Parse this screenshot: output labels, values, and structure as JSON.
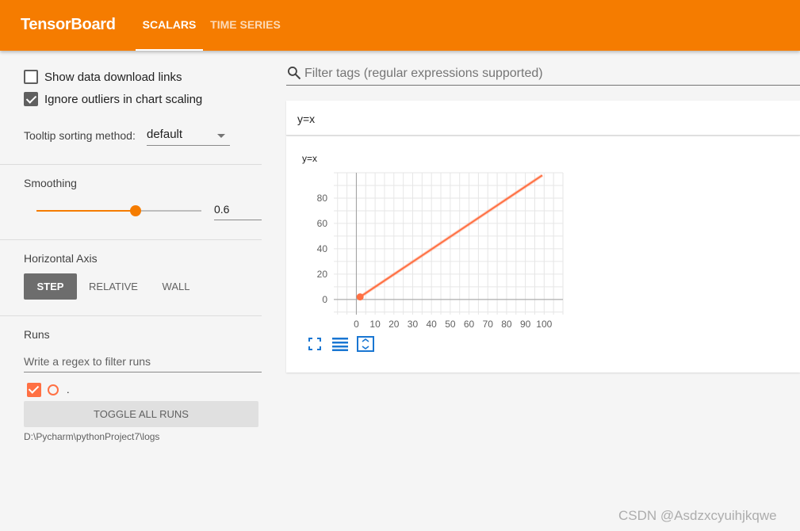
{
  "header": {
    "brand": "TensorBoard",
    "tabs": [
      {
        "label": "SCALARS",
        "active": true
      },
      {
        "label": "TIME SERIES",
        "active": false
      }
    ],
    "accent_color": "#f57c00"
  },
  "sidebar": {
    "show_download_links": {
      "label": "Show data download links",
      "checked": false
    },
    "ignore_outliers": {
      "label": "Ignore outliers in chart scaling",
      "checked": true
    },
    "tooltip_sorting": {
      "label": "Tooltip sorting method:",
      "value": "default"
    },
    "smoothing": {
      "title": "Smoothing",
      "value": "0.6",
      "fraction": 0.6
    },
    "horizontal_axis": {
      "title": "Horizontal Axis",
      "options": [
        "STEP",
        "RELATIVE",
        "WALL"
      ],
      "selected": "STEP"
    },
    "runs": {
      "title": "Runs",
      "filter_placeholder": "Write a regex to filter runs",
      "items": [
        {
          "name": ".",
          "checked": true,
          "color": "#ff7043"
        }
      ],
      "toggle_all_label": "TOGGLE ALL RUNS",
      "logdir": "D:\\Pycharm\\pythonProject7\\logs"
    }
  },
  "main": {
    "filter_placeholder": "Filter tags (regular expressions supported)",
    "card": {
      "header": "y=x",
      "chart_title": "y=x",
      "icons": [
        "fullscreen-icon",
        "toggle-log-scale-icon",
        "fit-domain-icon"
      ]
    }
  },
  "watermark": "CSDN @Asdzxcyuihjkqwe",
  "chart_data": {
    "type": "line",
    "title": "y=x",
    "xlabel": "",
    "ylabel": "",
    "x_ticks": [
      0,
      10,
      20,
      30,
      40,
      50,
      60,
      70,
      80,
      90,
      100
    ],
    "y_ticks": [
      0,
      20,
      40,
      60,
      80
    ],
    "xlim": [
      -12,
      110
    ],
    "ylim": [
      -12,
      100
    ],
    "grid": true,
    "series": [
      {
        "color": "#ff7043",
        "x": [
          2,
          99
        ],
        "y": [
          2,
          98
        ]
      }
    ]
  }
}
